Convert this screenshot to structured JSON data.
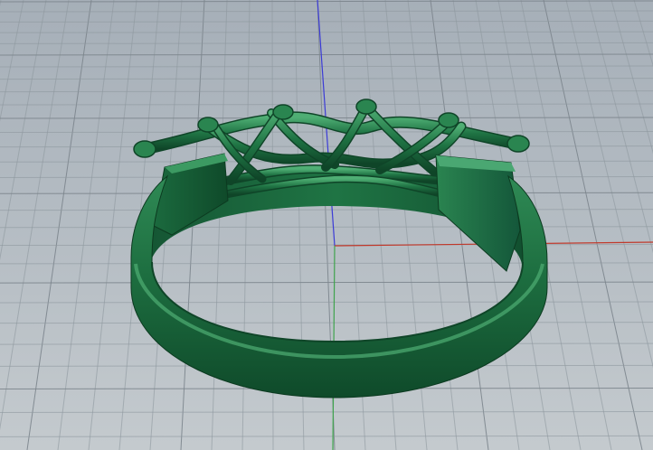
{
  "viewport": {
    "view": "perspective",
    "colors": {
      "background_top": "#a6afb8",
      "background_bottom": "#c4cace",
      "grid_minor": "#8e979f",
      "grid_major": "#7c858d",
      "axis_x": "#c0392b",
      "axis_y": "#3fa34d",
      "axis_z": "#3b3bd6",
      "model_dark": "#0d3b22",
      "model_mid": "#1c6b3f",
      "model_light": "#3c9a62",
      "model_highlight": "#6fc08d"
    },
    "model": {
      "name": "ring",
      "parts": [
        "shank",
        "crown-lattice",
        "end-blocks"
      ]
    },
    "axes": [
      "x",
      "y",
      "z"
    ]
  }
}
